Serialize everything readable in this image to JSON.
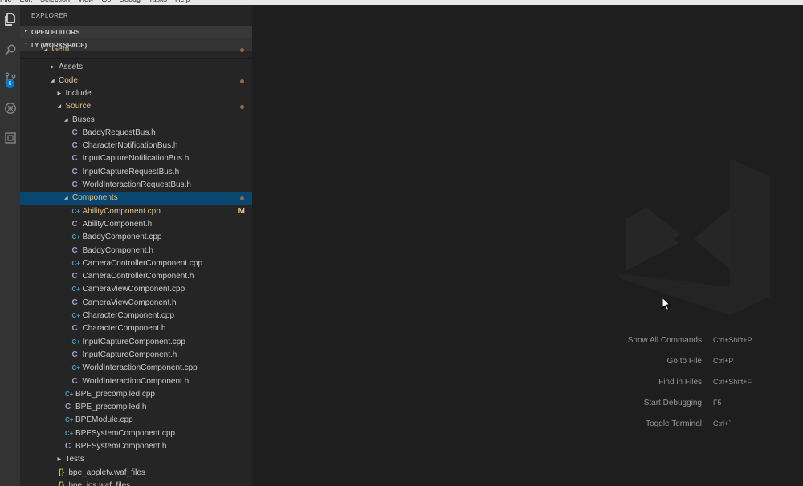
{
  "menubar": [
    "File",
    "Edit",
    "Selection",
    "View",
    "Go",
    "Debug",
    "Tasks",
    "Help"
  ],
  "activity": {
    "icons": [
      "files-icon",
      "search-icon",
      "source-control-icon",
      "debug-icon",
      "extensions-icon"
    ],
    "scm_badge": "6"
  },
  "sidebar": {
    "title": "EXPLORER",
    "sections": {
      "open_editors": "OPEN EDITORS",
      "workspace": "LY (WORKSPACE)"
    }
  },
  "tree": [
    {
      "label": "Gem",
      "depth": 3,
      "type": "folder",
      "open": true,
      "modified": true,
      "partial": true
    },
    {
      "label": "Assets",
      "depth": 4,
      "type": "folder",
      "open": false
    },
    {
      "label": "Code",
      "depth": 4,
      "type": "folder",
      "open": true,
      "modified": true
    },
    {
      "label": "Include",
      "depth": 5,
      "type": "folder",
      "open": false
    },
    {
      "label": "Source",
      "depth": 5,
      "type": "folder",
      "open": true,
      "modified": true
    },
    {
      "label": "Buses",
      "depth": 6,
      "type": "folder",
      "open": true
    },
    {
      "label": "BaddyRequestBus.h",
      "depth": 7,
      "type": "h"
    },
    {
      "label": "CharacterNotificationBus.h",
      "depth": 7,
      "type": "h"
    },
    {
      "label": "InputCaptureNotificationBus.h",
      "depth": 7,
      "type": "h"
    },
    {
      "label": "InputCaptureRequestBus.h",
      "depth": 7,
      "type": "h"
    },
    {
      "label": "WorldInteractionRequestBus.h",
      "depth": 7,
      "type": "h"
    },
    {
      "label": "Components",
      "depth": 6,
      "type": "folder",
      "open": true,
      "modified": true,
      "selected": true
    },
    {
      "label": "AbilityComponent.cpp",
      "depth": 7,
      "type": "cpp",
      "status": "M"
    },
    {
      "label": "AbilityComponent.h",
      "depth": 7,
      "type": "h"
    },
    {
      "label": "BaddyComponent.cpp",
      "depth": 7,
      "type": "cpp"
    },
    {
      "label": "BaddyComponent.h",
      "depth": 7,
      "type": "h"
    },
    {
      "label": "CameraControllerComponent.cpp",
      "depth": 7,
      "type": "cpp"
    },
    {
      "label": "CameraControllerComponent.h",
      "depth": 7,
      "type": "h"
    },
    {
      "label": "CameraViewComponent.cpp",
      "depth": 7,
      "type": "cpp"
    },
    {
      "label": "CameraViewComponent.h",
      "depth": 7,
      "type": "h"
    },
    {
      "label": "CharacterComponent.cpp",
      "depth": 7,
      "type": "cpp"
    },
    {
      "label": "CharacterComponent.h",
      "depth": 7,
      "type": "h"
    },
    {
      "label": "InputCaptureComponent.cpp",
      "depth": 7,
      "type": "cpp"
    },
    {
      "label": "InputCaptureComponent.h",
      "depth": 7,
      "type": "h"
    },
    {
      "label": "WorldInteractionComponent.cpp",
      "depth": 7,
      "type": "cpp"
    },
    {
      "label": "WorldInteractionComponent.h",
      "depth": 7,
      "type": "h"
    },
    {
      "label": "BPE_precompiled.cpp",
      "depth": 6,
      "type": "cpp"
    },
    {
      "label": "BPE_precompiled.h",
      "depth": 6,
      "type": "h"
    },
    {
      "label": "BPEModule.cpp",
      "depth": 6,
      "type": "cpp"
    },
    {
      "label": "BPESystemComponent.cpp",
      "depth": 6,
      "type": "cpp"
    },
    {
      "label": "BPESystemComponent.h",
      "depth": 6,
      "type": "h"
    },
    {
      "label": "Tests",
      "depth": 5,
      "type": "folder",
      "open": false
    },
    {
      "label": "bpe_appletv.waf_files",
      "depth": 5,
      "type": "json"
    },
    {
      "label": "bpe_ios.waf_files",
      "depth": 5,
      "type": "json"
    }
  ],
  "icon_glyphs": {
    "cpp": "C+",
    "h": "C",
    "json": "{}"
  },
  "colors": {
    "modified": "#e2c08d",
    "selection": "#094771",
    "cpp_icon": "#519aba"
  },
  "editor": {
    "commands": [
      {
        "label": "Show All Commands",
        "key": "Ctrl+Shift+P"
      },
      {
        "label": "Go to File",
        "key": "Ctrl+P"
      },
      {
        "label": "Find in Files",
        "key": "Ctrl+Shift+F"
      },
      {
        "label": "Start Debugging",
        "key": "F5"
      },
      {
        "label": "Toggle Terminal",
        "key": "Ctrl+`"
      }
    ]
  }
}
